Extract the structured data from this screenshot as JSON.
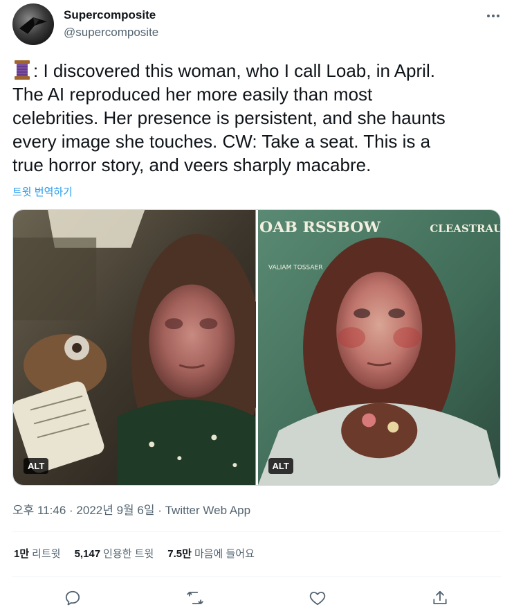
{
  "author": {
    "name": "Supercomposite",
    "handle": "@supercomposite",
    "avatar_icon": "stealth-aircraft-avatar"
  },
  "tweet": {
    "emoji": "thread-spool-emoji",
    "lines": [
      ": I discovered this woman, who I call Loab, in April.",
      "The AI reproduced her more easily than most",
      "celebrities. Her presence is persistent, and she haunts",
      "every image she touches. CW: Take a seat. This is a",
      "true horror story, and veers sharply macabre."
    ],
    "translate_label": "트윗 번역하기"
  },
  "media": {
    "images": [
      {
        "alt_label": "ALT"
      },
      {
        "alt_label": "ALT",
        "overlay_title": "OAB RSSBOW",
        "overlay_top_right": "CLEASTRAU TO",
        "overlay_small": "VALIAM TOSSAER"
      }
    ]
  },
  "meta": {
    "time": "오후 11:46",
    "separator": " · ",
    "date": "2022년 9월 6일",
    "app": "Twitter Web App"
  },
  "stats": {
    "retweets_count": "1만",
    "retweets_label": "리트윗",
    "quotes_count": "5,147",
    "quotes_label": "인용한 트윗",
    "likes_count": "7.5만",
    "likes_label": "마음에 들어요"
  },
  "actions": {
    "icons": [
      "reply-icon",
      "retweet-icon",
      "like-icon",
      "share-icon"
    ]
  },
  "colors": {
    "link": "#1d9bf0",
    "secondary_text": "#536471",
    "primary_text": "#0f1419",
    "border": "#eff3f4"
  }
}
